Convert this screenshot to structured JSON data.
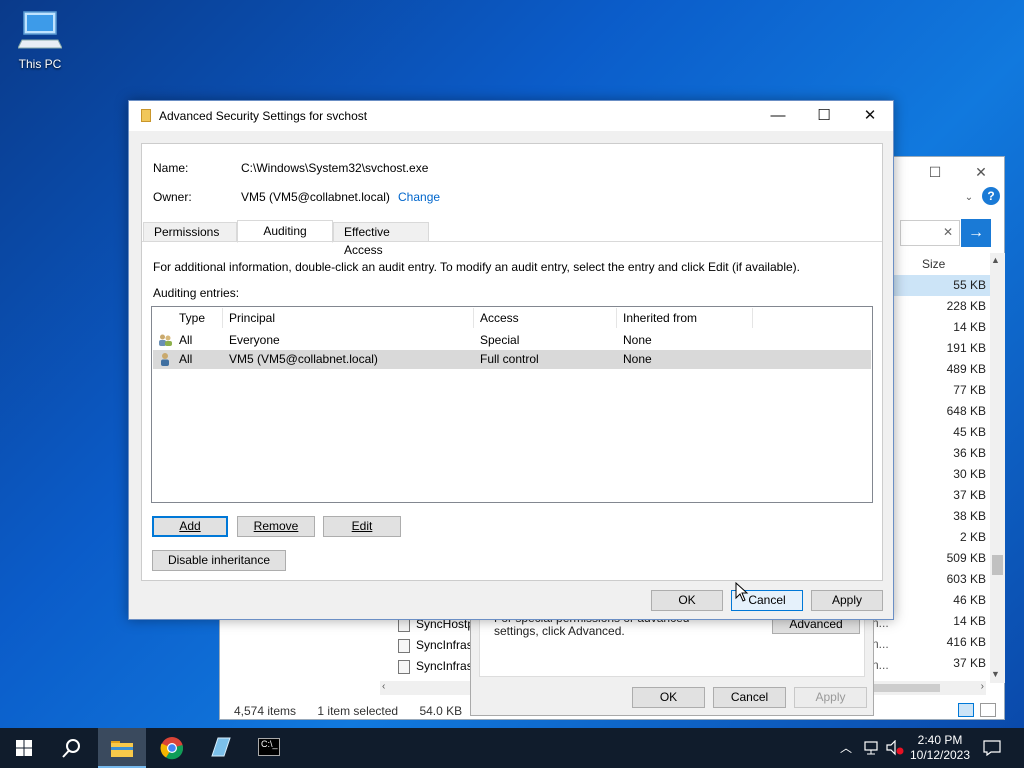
{
  "desktop": {
    "icon_label": "This PC"
  },
  "explorer": {
    "column_size": "Size",
    "sizes": [
      "55 KB",
      "228 KB",
      "14 KB",
      "191 KB",
      "489 KB",
      "77 KB",
      "648 KB",
      "45 KB",
      "36 KB",
      "30 KB",
      "37 KB",
      "38 KB",
      "2 KB",
      "509 KB",
      "603 KB",
      "46 KB",
      "14 KB",
      "416 KB",
      "37 KB"
    ],
    "truncated": [
      "...",
      "...",
      "...",
      "...",
      "...",
      "...",
      "...",
      "...",
      "...",
      "...",
      "...",
      "...",
      "e",
      "...",
      "...",
      "...",
      "ten...",
      "ten...",
      "ten..."
    ],
    "files": [
      "SyncHostp",
      "SyncInfras",
      "SyncInfras"
    ],
    "status_count": "4,574 items",
    "status_selected": "1 item selected",
    "status_size": "54.0 KB"
  },
  "props_dialog": {
    "text": "For special permissions or advanced settings, click Advanced.",
    "advanced": "Advanced",
    "ok": "OK",
    "cancel": "Cancel",
    "apply": "Apply"
  },
  "dialog": {
    "title": "Advanced Security Settings for svchost",
    "name_label": "Name:",
    "name_value": "C:\\Windows\\System32\\svchost.exe",
    "owner_label": "Owner:",
    "owner_value": "VM5 (VM5@collabnet.local)",
    "change_link": "Change",
    "tabs": [
      "Permissions",
      "Auditing",
      "Effective Access"
    ],
    "active_tab": "Auditing",
    "info_text": "For additional information, double-click an audit entry. To modify an audit entry, select the entry and click Edit (if available).",
    "entries_label": "Auditing entries:",
    "columns": [
      "Type",
      "Principal",
      "Access",
      "Inherited from"
    ],
    "rows": [
      {
        "type": "All",
        "principal": "Everyone",
        "access": "Special",
        "inherited": "None",
        "icon": "group-icon"
      },
      {
        "type": "All",
        "principal": "VM5 (VM5@collabnet.local)",
        "access": "Full control",
        "inherited": "None",
        "icon": "user-icon"
      }
    ],
    "add": "Add",
    "remove": "Remove",
    "edit": "Edit",
    "disable_inheritance": "Disable inheritance",
    "ok": "OK",
    "cancel": "Cancel",
    "apply": "Apply"
  },
  "taskbar": {
    "time": "2:40 PM",
    "date": "10/12/2023"
  }
}
